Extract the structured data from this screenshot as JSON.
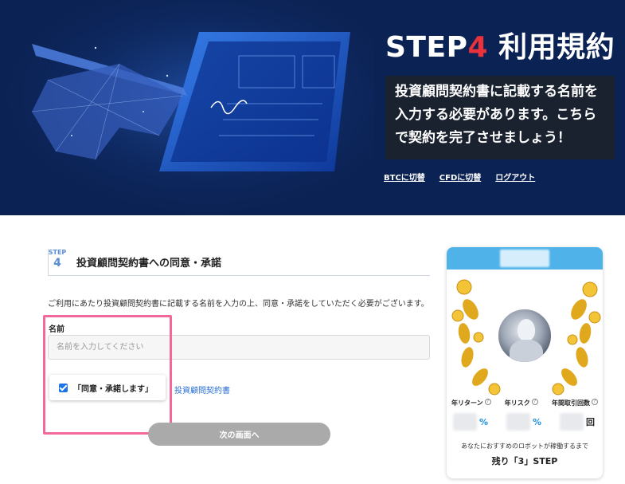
{
  "hero": {
    "title_prefix": "STEP",
    "title_num": "4",
    "title_suffix": " 利用規約",
    "description": "投資顧問契約書に記載する名前を入力する必要があります。こちらで契約を完了させましょう！",
    "links": [
      "BTCに切替",
      "CFDに切替",
      "ログアウト"
    ]
  },
  "step": {
    "badge_label": "STEP",
    "badge_num": "4",
    "title": "投資顧問契約書への同意・承諾",
    "intro": "ご利用にあたり投資顧問契約書に記載する名前を入力の上、同意・承諾をしていただく必要がございます。"
  },
  "form": {
    "name_label": "名前",
    "name_placeholder": "名前を入力してください",
    "name_value": "",
    "agree_label": "「同意・承諾します」",
    "agree_checked": true,
    "contract_link": "投資顧問契約書",
    "next_button": "次の画面へ"
  },
  "card": {
    "stat_labels": [
      "年リターン",
      "年リスク",
      "年間取引回数"
    ],
    "units": [
      "%",
      "%",
      "回"
    ],
    "note": "あなたにおすすめのロボットが稼働するまで",
    "remain": "残り「3」STEP"
  },
  "colors": {
    "hero_bg": "#0b2254",
    "accent_red": "#e8323c",
    "link_blue": "#2a6fd6",
    "highlight_pink": "#f2689a",
    "card_head": "#4fb3ea"
  }
}
